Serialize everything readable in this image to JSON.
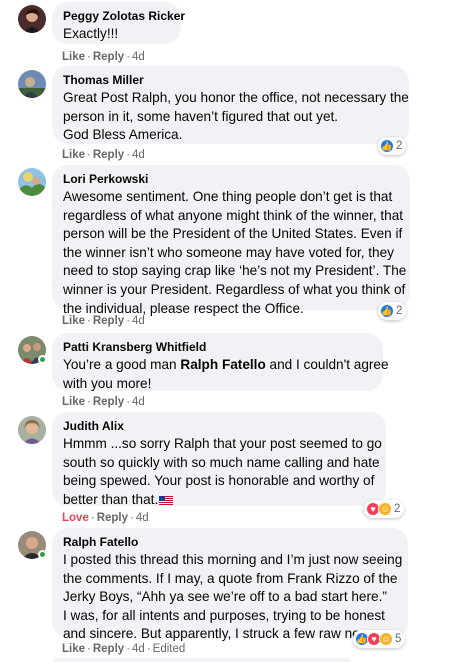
{
  "colors": {
    "bubble": "#f0f2f5",
    "meta": "#65676b",
    "like_blue": "#1877f2",
    "love_red": "#f33e58",
    "haha_yellow": "#f7b125",
    "online_green": "#31a24c"
  },
  "actions": {
    "like": "Like",
    "reply": "Reply",
    "love": "Love",
    "dot": "·",
    "edited": "Edited"
  },
  "comments": [
    {
      "author": "Peggy Zolotas Ricker",
      "lines": [
        "Exactly!!!"
      ],
      "time": "4d",
      "reaction": null
    },
    {
      "author": "Thomas Miller",
      "lines": [
        "Great Post Ralph, you honor the office, not necessary the",
        "person in it, some haven’t figured that out yet.",
        "God Bless America."
      ],
      "time": "4d",
      "reaction": {
        "icons": [
          "like-icon"
        ],
        "count": "2"
      }
    },
    {
      "author": "Lori Perkowski",
      "lines": [
        "Awesome sentiment. One thing people don’t get is that",
        "regardless of what anyone might think of the winner, that",
        "person will be the President of the United States. Even if",
        "the winner isn’t who someone may have voted for, they",
        "need to stop saying crap like ‘he’s not my President’. The",
        "winner is your President. Regardless of what you think of",
        "the individual, please respect the Office."
      ],
      "time": "4d",
      "reaction": {
        "icons": [
          "like-icon"
        ],
        "count": "2"
      }
    },
    {
      "author": "Patti Kransberg Whitfield",
      "line1_pre": "You’re a good man ",
      "line1_mention": "Ralph Fatello",
      "line1_post": " and I couldn't agree",
      "line2": "with you more!",
      "time": "4d",
      "reaction": null
    },
    {
      "author": "Judith Alix",
      "lines": [
        "Hmmm ...so sorry Ralph that your post seemed to go",
        "south so quickly with so much name calling and hate",
        "being spewed. Your post is honorable and worthy of",
        "better than that."
      ],
      "time": "4d",
      "reaction": {
        "icons": [
          "love-icon",
          "haha-icon"
        ],
        "count": "2"
      }
    },
    {
      "author": "Ralph Fatello",
      "lines": [
        "I posted this thread this morning and I’m just now seeing",
        "the comments. If I may, a quote from Frank Rizzo of the",
        "Jerky Boys, “Ahh ya see we’re off to a bad start here.”",
        "I was, for all intents and purposes, trying to be honest",
        "and sincere. But apparently, I struck a few raw nerves."
      ],
      "time": "4d",
      "reaction": {
        "icons": [
          "like-icon",
          "love-icon",
          "haha-icon"
        ],
        "count": "5"
      }
    }
  ]
}
